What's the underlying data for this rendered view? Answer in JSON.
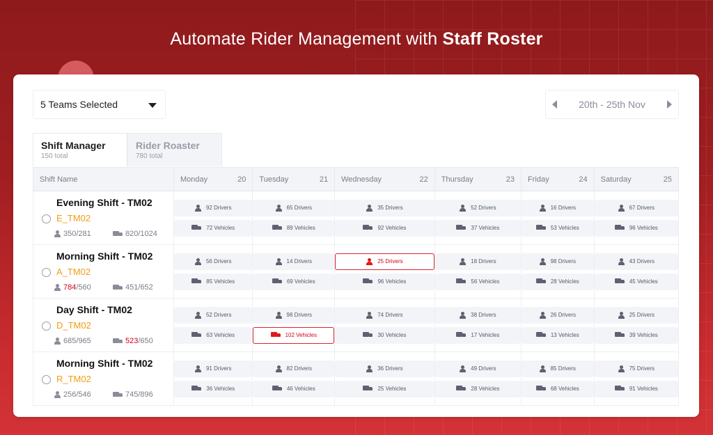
{
  "headline": {
    "regular": "Automate Rider Management with ",
    "bold": "Staff Roster"
  },
  "team_select": {
    "value": "5 Teams Selected"
  },
  "date_range": {
    "label": "20th - 25th Nov"
  },
  "tabs": [
    {
      "label": "Shift Manager",
      "sub": "150 total",
      "active": true
    },
    {
      "label": "Rider Roaster",
      "sub": "780 total",
      "active": false
    }
  ],
  "table": {
    "shift_header": "Shift Name",
    "days": [
      {
        "name": "Monday",
        "num": "20"
      },
      {
        "name": "Tuesday",
        "num": "21"
      },
      {
        "name": "Wednesday",
        "num": "22"
      },
      {
        "name": "Thursday",
        "num": "23"
      },
      {
        "name": "Friday",
        "num": "24"
      },
      {
        "name": "Saturday",
        "num": "25"
      }
    ],
    "rows": [
      {
        "title": "Evening Shift - TM02",
        "code": "E_TM02",
        "drivers_used": "350",
        "drivers_total": "/281",
        "drivers_over": false,
        "vehicles_used": "820",
        "vehicles_total": "/1024",
        "vehicles_over": false,
        "cells": [
          {
            "drivers": "92 Drivers",
            "vehicles": "72 Vehicles"
          },
          {
            "drivers": "65 Drivers",
            "vehicles": "89 Vehicles"
          },
          {
            "drivers": "35 Drivers",
            "vehicles": "92 Vehicles"
          },
          {
            "drivers": "52 Drivers",
            "vehicles": "37 Vehicles"
          },
          {
            "drivers": "16 Drivers",
            "vehicles": "53 Vehicles"
          },
          {
            "drivers": "67 Drivers",
            "vehicles": "96 Vehicles"
          }
        ]
      },
      {
        "title": "Morning Shift - TM02",
        "code": "A_TM02",
        "drivers_used": "784",
        "drivers_total": "/560",
        "drivers_over": true,
        "vehicles_used": "451",
        "vehicles_total": "/652",
        "vehicles_over": false,
        "cells": [
          {
            "drivers": "56 Drivers",
            "vehicles": "85 Vehicles"
          },
          {
            "drivers": "14 Drivers",
            "vehicles": "69 Vehicles"
          },
          {
            "drivers": "25 Drivers",
            "vehicles": "96 Vehicles",
            "drivers_alert": true
          },
          {
            "drivers": "18 Drivers",
            "vehicles": "56 Vehicles"
          },
          {
            "drivers": "98 Drivers",
            "vehicles": "28 Vehicles"
          },
          {
            "drivers": "43 Drivers",
            "vehicles": "45 Vehicles"
          }
        ]
      },
      {
        "title": "Day Shift - TM02",
        "code": "D_TM02",
        "drivers_used": "685",
        "drivers_total": "/965",
        "drivers_over": false,
        "vehicles_used": "523",
        "vehicles_total": "/650",
        "vehicles_over": true,
        "cells": [
          {
            "drivers": "52 Drivers",
            "vehicles": "63 Vehicles"
          },
          {
            "drivers": "98 Drivers",
            "vehicles": "102 Vehicles",
            "vehicles_alert": true
          },
          {
            "drivers": "74 Drivers",
            "vehicles": "30 Vehicles"
          },
          {
            "drivers": "38 Drivers",
            "vehicles": "17 Vehicles"
          },
          {
            "drivers": "26 Drivers",
            "vehicles": "13 Vehicles"
          },
          {
            "drivers": "25 Drivers",
            "vehicles": "39 Vehicles"
          }
        ]
      },
      {
        "title": "Morning Shift - TM02",
        "code": "R_TM02",
        "drivers_used": "256",
        "drivers_total": "/546",
        "drivers_over": false,
        "vehicles_used": "745",
        "vehicles_total": "/896",
        "vehicles_over": false,
        "cells": [
          {
            "drivers": "91 Drivers",
            "vehicles": "36 Vehicles"
          },
          {
            "drivers": "82 Drivers",
            "vehicles": "46 Vehicles"
          },
          {
            "drivers": "36 Drivers",
            "vehicles": "25 Vehicles"
          },
          {
            "drivers": "49 Drivers",
            "vehicles": "28 Vehicles"
          },
          {
            "drivers": "85 Drivers",
            "vehicles": "68 Vehicles"
          },
          {
            "drivers": "75 Drivers",
            "vehicles": "91 Vehicles"
          }
        ]
      }
    ]
  },
  "colors": {
    "brand_red": "#a01e21",
    "alert_red": "#d0021b",
    "code_orange": "#f39c12"
  }
}
